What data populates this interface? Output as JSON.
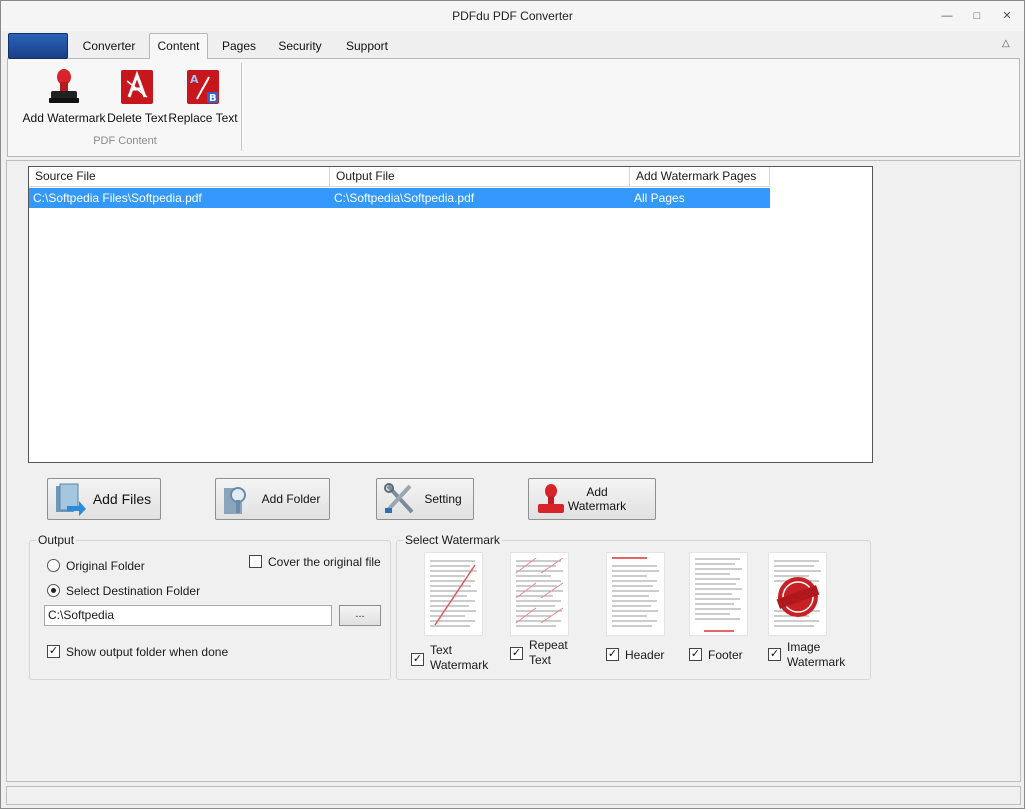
{
  "window": {
    "title": "PDFdu PDF Converter"
  },
  "ribbon": {
    "tabs": [
      {
        "label": "Converter"
      },
      {
        "label": "Content"
      },
      {
        "label": "Pages"
      },
      {
        "label": "Security"
      },
      {
        "label": "Support"
      }
    ],
    "active_tab": "Content",
    "buttons": [
      {
        "label": "Add Watermark",
        "icon": "stamp-icon"
      },
      {
        "label": "Delete Text",
        "icon": "pdf-delete-text-icon"
      },
      {
        "label": "Replace Text",
        "icon": "pdf-replace-text-icon"
      }
    ],
    "group_label": "PDF Content"
  },
  "file_list": {
    "columns": [
      "Source File",
      "Output File",
      "Add Watermark Pages"
    ],
    "rows": [
      {
        "source": "C:\\Softpedia Files\\Softpedia.pdf",
        "output": "C:\\Softpedia\\Softpedia.pdf",
        "pages": "All Pages"
      }
    ]
  },
  "actions": {
    "add_files": "Add Files",
    "add_folder": "Add Folder",
    "setting": "Setting",
    "add_watermark_line1": "Add",
    "add_watermark_line2": "Watermark"
  },
  "output": {
    "title": "Output",
    "original_folder": "Original Folder",
    "select_destination": "Select Destination Folder",
    "selected_option": "Select Destination Folder",
    "cover_original": "Cover the original file",
    "cover_original_checked": false,
    "path": "C:\\Softpedia",
    "browse": "...",
    "show_output": "Show output folder when done",
    "show_output_checked": true
  },
  "select_watermark": {
    "title": "Select Watermark",
    "items": [
      {
        "line1": "Text",
        "line2": "Watermark",
        "checked": true
      },
      {
        "line1": "Repeat",
        "line2": "Text",
        "checked": true
      },
      {
        "line1": "Header",
        "line2": "",
        "checked": true
      },
      {
        "line1": "Footer",
        "line2": "",
        "checked": true
      },
      {
        "line1": "Image",
        "line2": "Watermark",
        "checked": true
      }
    ]
  },
  "colors": {
    "selection": "#3399ff",
    "app_button": "#1f4f9e",
    "stamp_red": "#d8232a"
  }
}
